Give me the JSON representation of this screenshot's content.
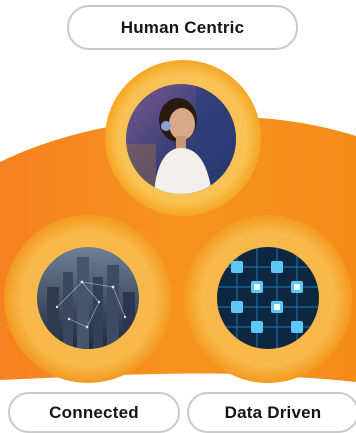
{
  "labels": {
    "top": "Human Centric",
    "left": "Connected",
    "right": "Data Driven"
  },
  "images": {
    "top": "woman-portrait-image",
    "left": "city-skyline-image",
    "right": "circuit-board-image"
  },
  "colors": {
    "accent": "#F7931E",
    "accent_light": "#FBB040",
    "ring_fill": "#F6B73C",
    "pill_border": "#C9C9C9",
    "text": "#151515"
  }
}
